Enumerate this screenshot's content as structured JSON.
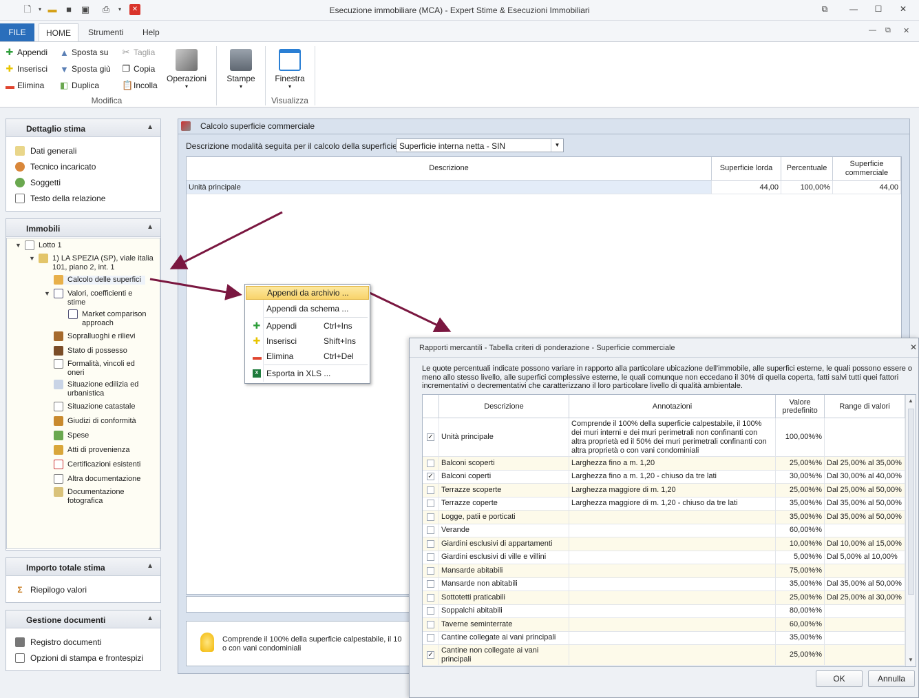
{
  "window": {
    "title": "Esecuzione immobiliare (MCA) - Expert Stime & Esecuzioni Immobiliari"
  },
  "menu": {
    "file": "FILE",
    "tabs": [
      "HOME",
      "Strumenti",
      "Help"
    ]
  },
  "ribbon": {
    "col1": [
      "Appendi",
      "Inserisci",
      "Elimina"
    ],
    "col2": [
      "Sposta su",
      "Sposta giù",
      "Duplica"
    ],
    "col3": [
      "Taglia",
      "Copia",
      "Incolla"
    ],
    "operazioni": "Operazioni",
    "stampe": "Stampe",
    "finestra": "Finestra",
    "group_modifica": "Modifica",
    "group_visualizza": "Visualizza"
  },
  "dettaglio": {
    "title": "Dettaglio stima",
    "items": [
      "Dati generali",
      "Tecnico incaricato",
      "Soggetti",
      "Testo della relazione"
    ]
  },
  "immobili": {
    "title": "Immobili",
    "lotto": "Lotto 1",
    "immobile": "1) LA SPEZIA (SP), viale italia 101, piano 2, int. 1",
    "nodes": [
      "Calcolo delle superfici",
      "Valori, coefficienti e stime",
      "Market comparison approach",
      "Sopralluoghi e rilievi",
      "Stato di possesso",
      "Formalità, vincoli ed oneri",
      "Situazione edilizia ed urbanistica",
      "Situazione catastale",
      "Giudizi di conformità",
      "Spese",
      "Atti di provenienza",
      "Certificazioni esistenti",
      "Altra documentazione",
      "Documentazione fotografica"
    ]
  },
  "importo": {
    "title": "Importo totale stima",
    "items": [
      "Riepilogo valori"
    ]
  },
  "gestione": {
    "title": "Gestione documenti",
    "items": [
      "Registro documenti",
      "Opzioni di stampa e frontespizi"
    ]
  },
  "main": {
    "title": "Calcolo superficie commerciale",
    "mode_label": "Descrizione modalità seguita per il calcolo della superficie:",
    "mode_value": "Superficie interna netta - SIN",
    "headers": [
      "Descrizione",
      "Superficie lorda",
      "Percentuale",
      "Superficie commerciale"
    ],
    "row": {
      "descr": "Unità principale",
      "lorda": "44,00",
      "perc": "100,00%",
      "comm": "44,00"
    },
    "hint": "Comprende il 100% della superficie calpestabile, il 10",
    "hint2": "o con vani condominiali"
  },
  "context_menu": {
    "items": [
      {
        "label": "Appendi da archivio ...",
        "shortcut": ""
      },
      {
        "label": "Appendi da schema ...",
        "shortcut": ""
      },
      {
        "label": "Appendi",
        "shortcut": "Ctrl+Ins"
      },
      {
        "label": "Inserisci",
        "shortcut": "Shift+Ins"
      },
      {
        "label": "Elimina",
        "shortcut": "Ctrl+Del"
      },
      {
        "label": "Esporta in XLS ...",
        "shortcut": ""
      }
    ]
  },
  "dialog": {
    "title": "Rapporti mercantili - Tabella criteri di ponderazione - Superficie commerciale",
    "intro": "Le quote percentuali indicate possono variare in rapporto alla particolare ubicazione dell'immobile, alle superfici esterne, le quali possono essere o meno allo stesso livello, alle superfici complessive esterne, le quali comunque non eccedano il 30% di quella coperta, fatti salvi tutti quei fattori incrementativi o decrementativi che caratterizzano il loro particolare livello di qualità ambientale.",
    "headers": [
      "Descrizione",
      "Annotazioni",
      "Valore predefinito",
      "Range di valori"
    ],
    "rows": [
      {
        "checked": true,
        "descr": "Unità principale",
        "note": "Comprende il 100% della superficie calpestabile, il 100% dei muri interni e dei muri perimetrali non confinanti con altra proprietà ed il 50% dei muri perimetrali confinanti con altra proprietà o con vani condominiali",
        "val": "100,00%%",
        "range": ""
      },
      {
        "checked": false,
        "descr": "Balconi scoperti",
        "note": "Larghezza fino a m. 1,20",
        "val": "25,00%%",
        "range": "Dal 25,00% al 35,00%"
      },
      {
        "checked": true,
        "descr": "Balconi coperti",
        "note": "Larghezza fino a m. 1,20 - chiuso da tre lati",
        "val": "30,00%%",
        "range": "Dal 30,00% al 40,00%"
      },
      {
        "checked": false,
        "descr": "Terrazze scoperte",
        "note": "Larghezza maggiore di m. 1,20",
        "val": "25,00%%",
        "range": "Dal 25,00% al 50,00%"
      },
      {
        "checked": false,
        "descr": "Terrazze coperte",
        "note": "Larghezza maggiore di m. 1,20 - chiuso da tre lati",
        "val": "35,00%%",
        "range": "Dal 35,00% al 50,00%"
      },
      {
        "checked": false,
        "descr": "Logge, patii e porticati",
        "note": "",
        "val": "35,00%%",
        "range": "Dal 35,00% al 50,00%"
      },
      {
        "checked": false,
        "descr": "Verande",
        "note": "",
        "val": "60,00%%",
        "range": ""
      },
      {
        "checked": false,
        "descr": "Giardini esclusivi di appartamenti",
        "note": "",
        "val": "10,00%%",
        "range": "Dal 10,00% al 15,00%"
      },
      {
        "checked": false,
        "descr": "Giardini esclusivi di ville e villini",
        "note": "",
        "val": "5,00%%",
        "range": "Dal 5,00% al 10,00%"
      },
      {
        "checked": false,
        "descr": "Mansarde abitabili",
        "note": "",
        "val": "75,00%%",
        "range": ""
      },
      {
        "checked": false,
        "descr": "Mansarde non abitabili",
        "note": "",
        "val": "35,00%%",
        "range": "Dal 35,00% al 50,00%"
      },
      {
        "checked": false,
        "descr": "Sottotetti praticabili",
        "note": "",
        "val": "25,00%%",
        "range": "Dal 25,00% al 30,00%"
      },
      {
        "checked": false,
        "descr": "Soppalchi abitabili",
        "note": "",
        "val": "80,00%%",
        "range": ""
      },
      {
        "checked": false,
        "descr": "Taverne seminterrate",
        "note": "",
        "val": "60,00%%",
        "range": ""
      },
      {
        "checked": false,
        "descr": "Cantine collegate ai vani principali",
        "note": "",
        "val": "35,00%%",
        "range": ""
      },
      {
        "checked": true,
        "descr": "Cantine non collegate ai vani principali",
        "note": "",
        "val": "25,00%%",
        "range": ""
      }
    ],
    "ok": "OK",
    "cancel": "Annulla"
  }
}
